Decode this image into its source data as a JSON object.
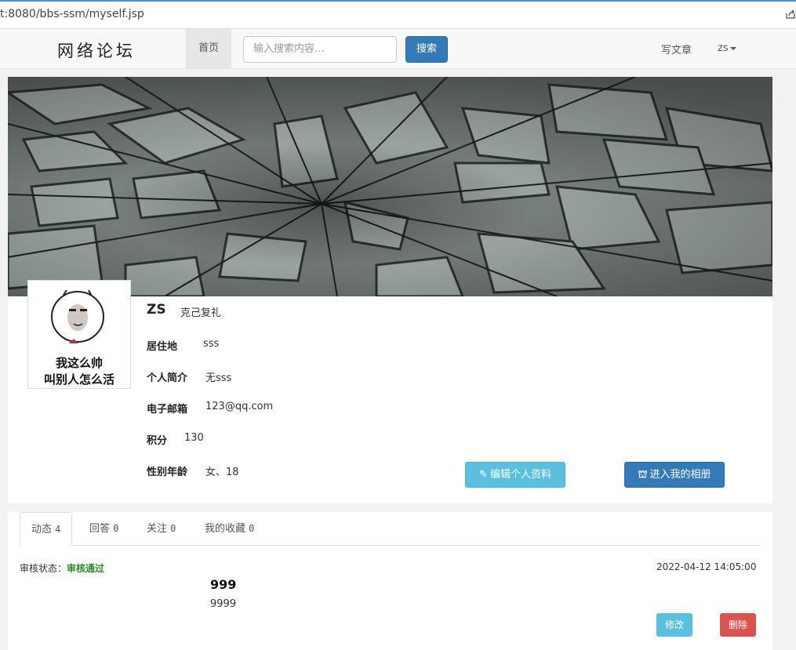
{
  "browser": {
    "url": "t:8080/bbs-ssm/myself.jsp"
  },
  "nav": {
    "brand": "网络论坛",
    "home": "首页",
    "search_placeholder": "输入搜索内容...",
    "search_button": "搜索",
    "write": "写文章",
    "user": "zs"
  },
  "profile": {
    "avatar_caption_1": "我这么帅",
    "avatar_caption_2": "叫别人怎么活",
    "username": "ZS",
    "motto": "克己复礼",
    "fields": [
      {
        "label": "居住地",
        "value": "sss"
      },
      {
        "label": "个人简介",
        "value": "无sss"
      },
      {
        "label": "电子邮箱",
        "value": "123@qq.com"
      },
      {
        "label": "积分",
        "value": "130"
      },
      {
        "label": "性别年龄",
        "value": "女、18"
      }
    ],
    "edit_button": "编辑个人资料",
    "album_button": "进入我的相册"
  },
  "tabs": [
    {
      "label": "动态",
      "count": "4"
    },
    {
      "label": "回答",
      "count": "0"
    },
    {
      "label": "关注",
      "count": "0"
    },
    {
      "label": "我的收藏",
      "count": "0"
    }
  ],
  "post": {
    "audit_label": "审核状态：",
    "audit_status": "审核通过",
    "time": "2022-04-12 14:05:00",
    "title": "999",
    "body": "9999",
    "edit": "修改",
    "delete": "删除"
  },
  "colors": {
    "primary": "#337ab7",
    "info": "#5bc0de",
    "danger": "#d9534f",
    "success_text": "#2d8a2d"
  }
}
